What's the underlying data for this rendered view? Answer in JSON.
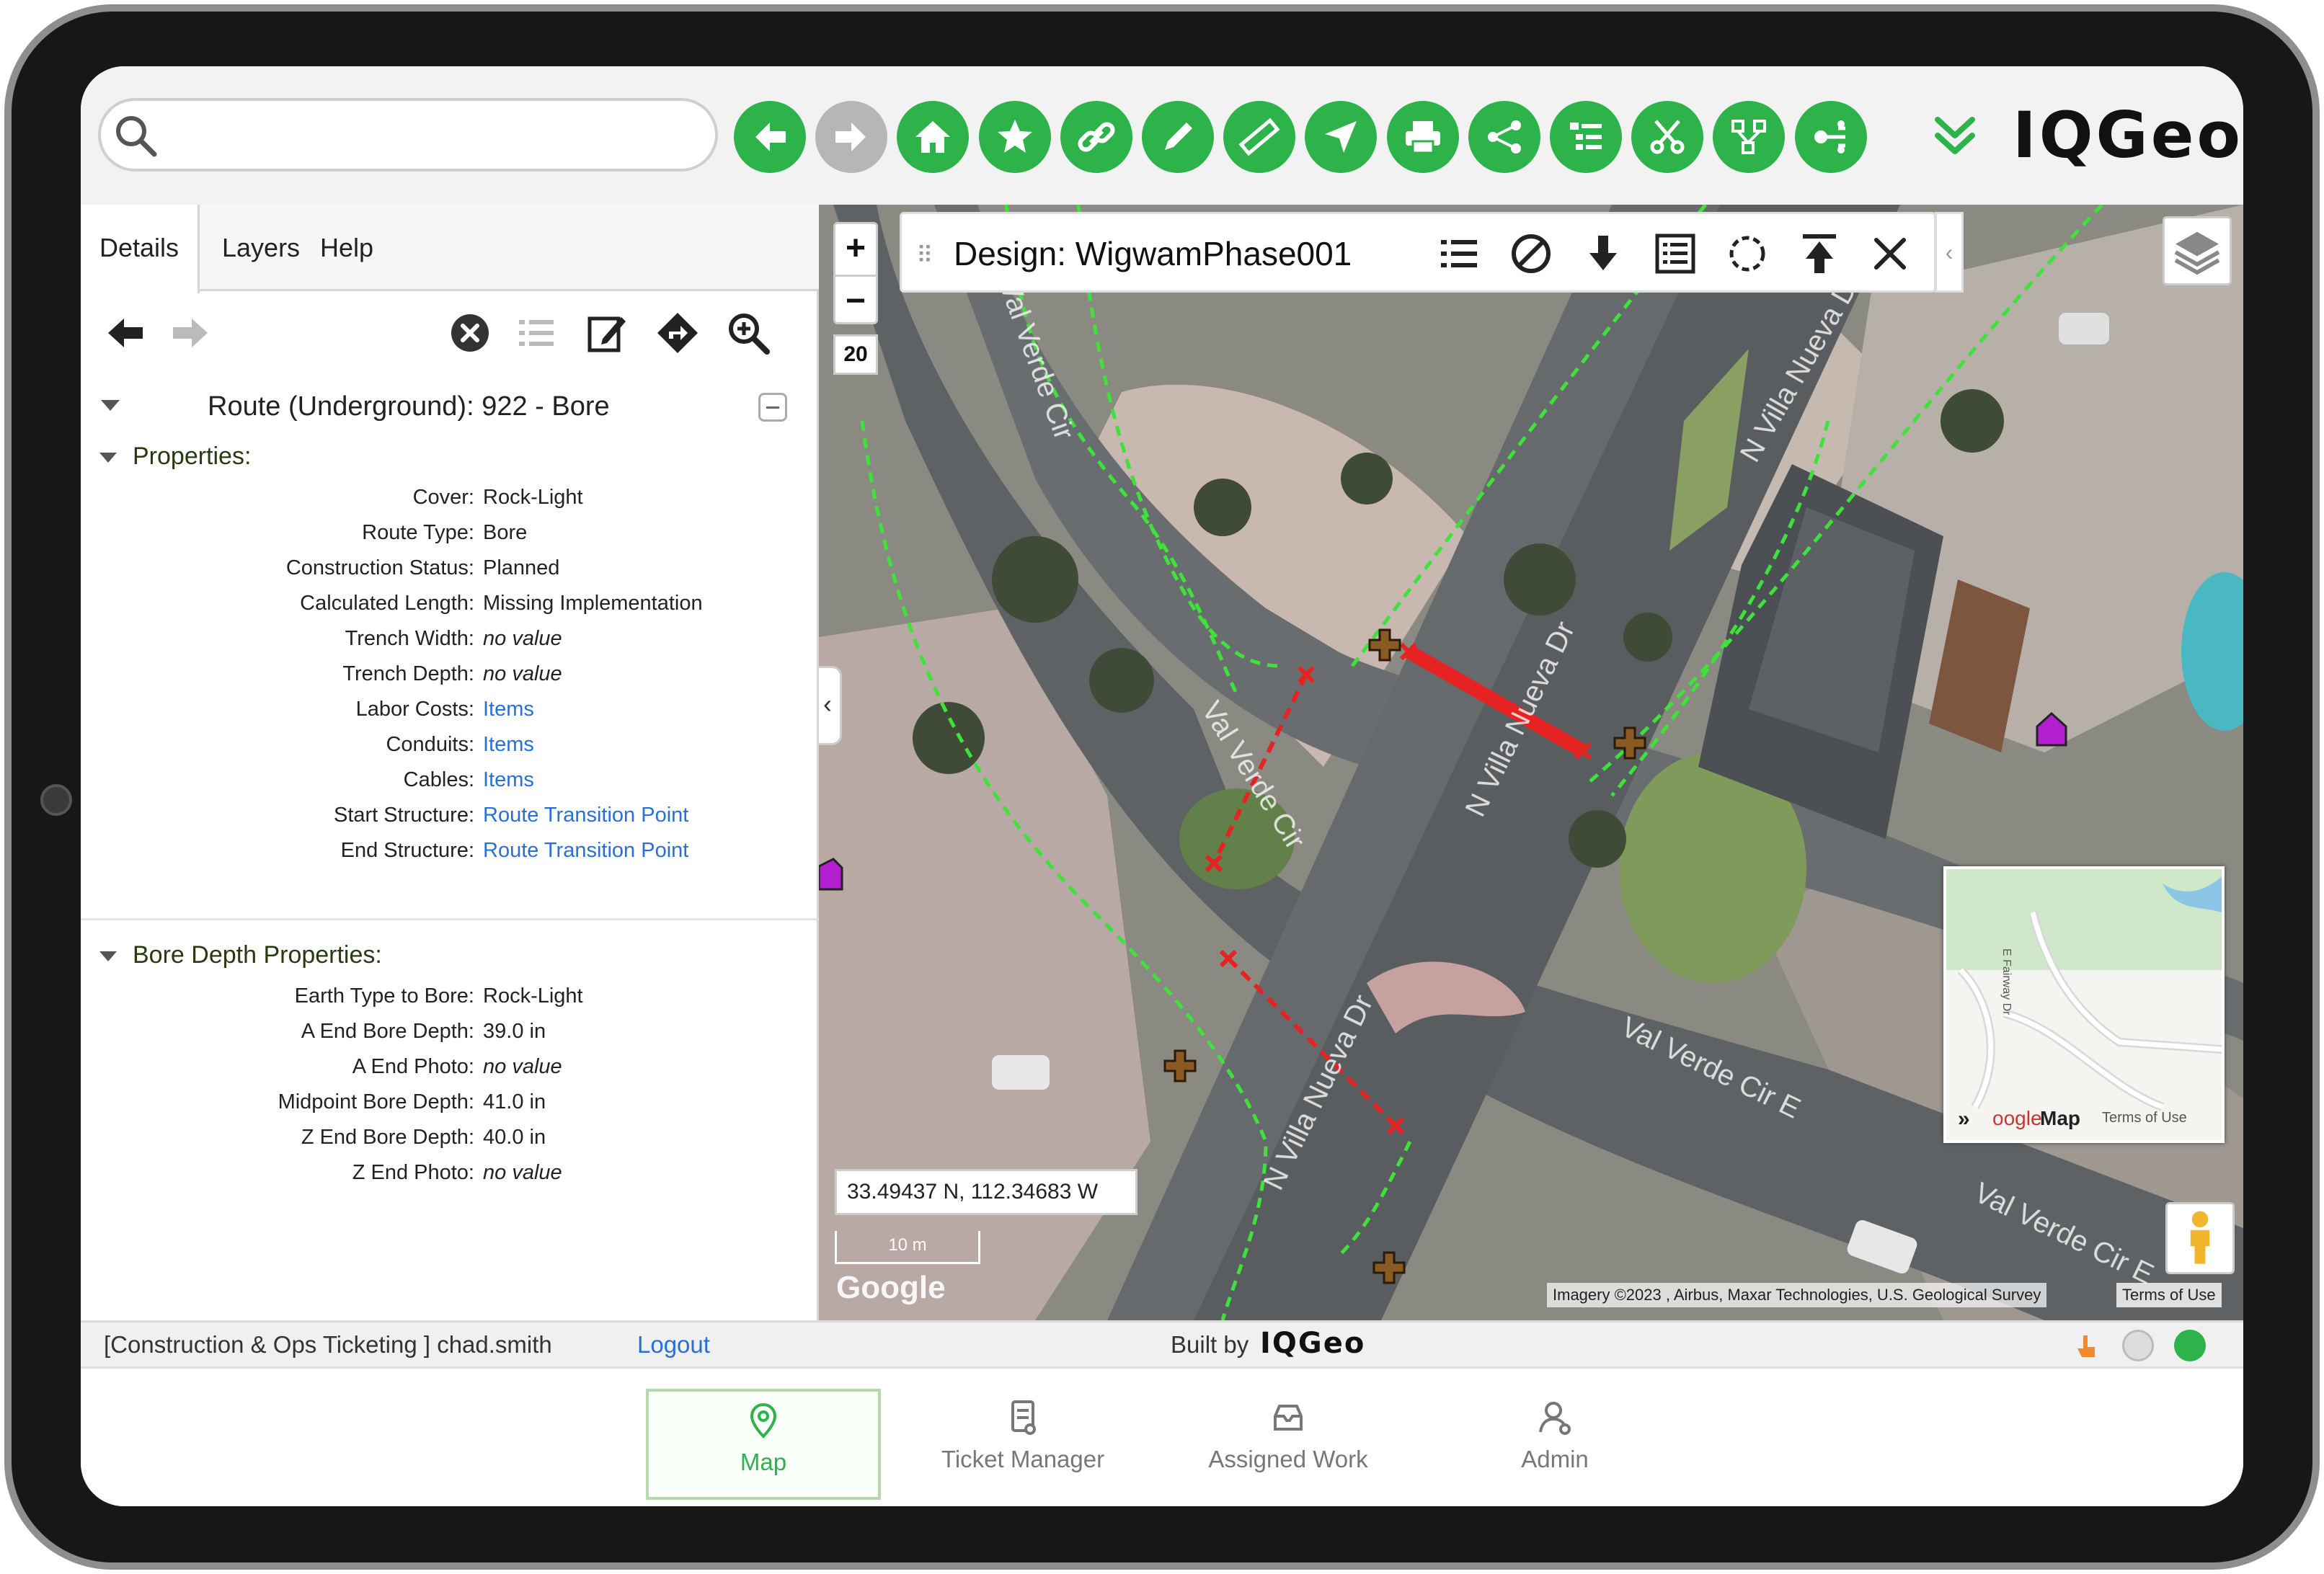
{
  "search": {
    "placeholder": ""
  },
  "toolbar": {
    "buttons": [
      {
        "name": "back",
        "icon": "arrow-left-icon",
        "enabled": true
      },
      {
        "name": "forward",
        "icon": "arrow-right-icon",
        "enabled": false
      },
      {
        "name": "home",
        "icon": "home-icon",
        "enabled": true
      },
      {
        "name": "bookmark",
        "icon": "star-icon",
        "enabled": true
      },
      {
        "name": "link",
        "icon": "link-icon",
        "enabled": true
      },
      {
        "name": "edit",
        "icon": "pencil-icon",
        "enabled": true
      },
      {
        "name": "measure",
        "icon": "ruler-icon",
        "enabled": true
      },
      {
        "name": "location",
        "icon": "navigate-icon",
        "enabled": true
      },
      {
        "name": "print",
        "icon": "printer-icon",
        "enabled": true
      },
      {
        "name": "share",
        "icon": "share-icon",
        "enabled": true
      },
      {
        "name": "tree",
        "icon": "tree-list-icon",
        "enabled": true
      },
      {
        "name": "tools",
        "icon": "scissors-icon",
        "enabled": true
      },
      {
        "name": "network",
        "icon": "network-icon",
        "enabled": true
      },
      {
        "name": "trace",
        "icon": "trace-icon",
        "enabled": true
      }
    ],
    "accent": "#2db34a",
    "disabled": "#b6b6b6"
  },
  "logo": {
    "text": "IQGeo"
  },
  "left_panel": {
    "tabs": [
      "Details",
      "Layers",
      "Help"
    ],
    "feature_title": "Route (Underground): 922 - Bore",
    "properties_header": "Properties:",
    "properties": [
      {
        "key": "Cover:",
        "value": "Rock-Light",
        "style": "plain"
      },
      {
        "key": "Route Type:",
        "value": "Bore",
        "style": "plain"
      },
      {
        "key": "Construction Status:",
        "value": "Planned",
        "style": "plain"
      },
      {
        "key": "Calculated Length:",
        "value": "Missing Implementation",
        "style": "plain"
      },
      {
        "key": "Trench Width:",
        "value": "no value",
        "style": "italic"
      },
      {
        "key": "Trench Depth:",
        "value": "no value",
        "style": "italic"
      },
      {
        "key": "Labor Costs:",
        "value": "Items",
        "style": "link"
      },
      {
        "key": "Conduits:",
        "value": "Items",
        "style": "link"
      },
      {
        "key": "Cables:",
        "value": "Items",
        "style": "link"
      },
      {
        "key": "Start Structure:",
        "value": "Route Transition Point",
        "style": "link"
      },
      {
        "key": "End Structure:",
        "value": "Route Transition Point",
        "style": "link"
      }
    ],
    "bore_header": "Bore Depth Properties:",
    "bore_properties": [
      {
        "key": "Earth Type to Bore:",
        "value": "Rock-Light",
        "style": "plain"
      },
      {
        "key": "A End Bore Depth:",
        "value": "39.0 in",
        "style": "plain"
      },
      {
        "key": "A End Photo:",
        "value": "no value",
        "style": "italic"
      },
      {
        "key": "Midpoint Bore Depth:",
        "value": "41.0 in",
        "style": "plain"
      },
      {
        "key": "Z End Bore Depth:",
        "value": "40.0 in",
        "style": "plain"
      },
      {
        "key": "Z End Photo:",
        "value": "no value",
        "style": "italic"
      }
    ]
  },
  "map": {
    "zoom_level": "20",
    "design_title": "Design: WigwamPhase001",
    "coords": "33.49437 N, 112.34683 W",
    "scale": "10 m",
    "google": "Google",
    "attribution": "Imagery ©2023 , Airbus, Maxar Technologies, U.S. Geological Survey",
    "terms": "Terms of Use",
    "street_labels": [
      "Val Verde Cir",
      "Val Verde Cir",
      "N Villa Nueva Dr",
      "N Villa Nueva Dr",
      "N Villa Nueva Dr",
      "Val Verde Cir E",
      "Val Verde Cir E"
    ],
    "minimap": {
      "label": "Map",
      "terms": "Terms of Use",
      "google": "oogle",
      "street": "E Fairway Dr"
    },
    "route_color": "#e52323",
    "cable_color": "#3fe23a"
  },
  "status": {
    "user": "[Construction & Ops Ticketing ] chad.smith",
    "logout": "Logout",
    "built_by": "Built by",
    "built_logo": "IQGeo"
  },
  "nav": [
    {
      "label": "Map",
      "icon": "map-pin-icon",
      "active": true
    },
    {
      "label": "Ticket Manager",
      "icon": "ticket-icon",
      "active": false
    },
    {
      "label": "Assigned Work",
      "icon": "inbox-icon",
      "active": false
    },
    {
      "label": "Admin",
      "icon": "admin-icon",
      "active": false
    }
  ]
}
